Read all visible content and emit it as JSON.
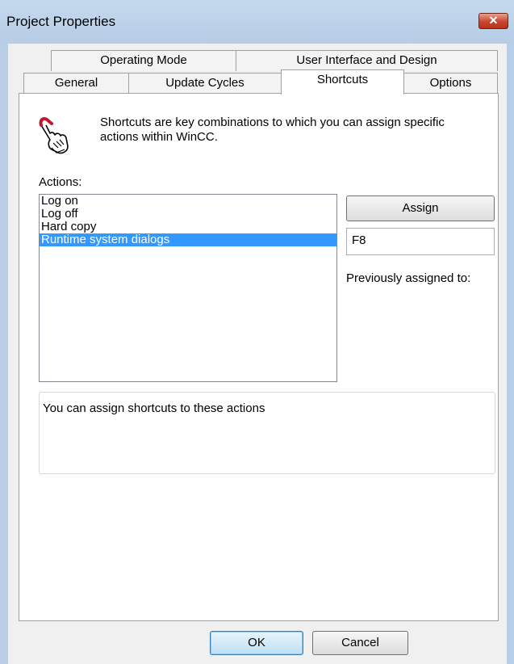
{
  "window": {
    "title": "Project Properties",
    "close_glyph": "✕"
  },
  "tabs_back": [
    {
      "label": "Operating Mode"
    },
    {
      "label": "User Interface and Design"
    }
  ],
  "tabs_front": [
    {
      "label": "General"
    },
    {
      "label": "Update Cycles"
    },
    {
      "label": "Shortcuts",
      "selected": true
    },
    {
      "label": "Options"
    }
  ],
  "shortcuts": {
    "icon": "hand-pointer-icon",
    "info": "Shortcuts are key combinations to which you can assign specific actions within WinCC.",
    "actions_label": "Actions:",
    "actions": [
      {
        "label": "Log on"
      },
      {
        "label": "Log off"
      },
      {
        "label": "Hard copy"
      },
      {
        "label": "Runtime system dialogs",
        "selected": true
      }
    ],
    "assign_label": "Assign",
    "key_value": "F8",
    "previously_assigned_label": "Previously assigned to:",
    "description": "You can assign shortcuts to these actions"
  },
  "footer": {
    "ok_label": "OK",
    "cancel_label": "Cancel"
  },
  "colors": {
    "selection": "#3399ff",
    "titlebar": "#c5d9ee",
    "close": "#c6452f"
  }
}
